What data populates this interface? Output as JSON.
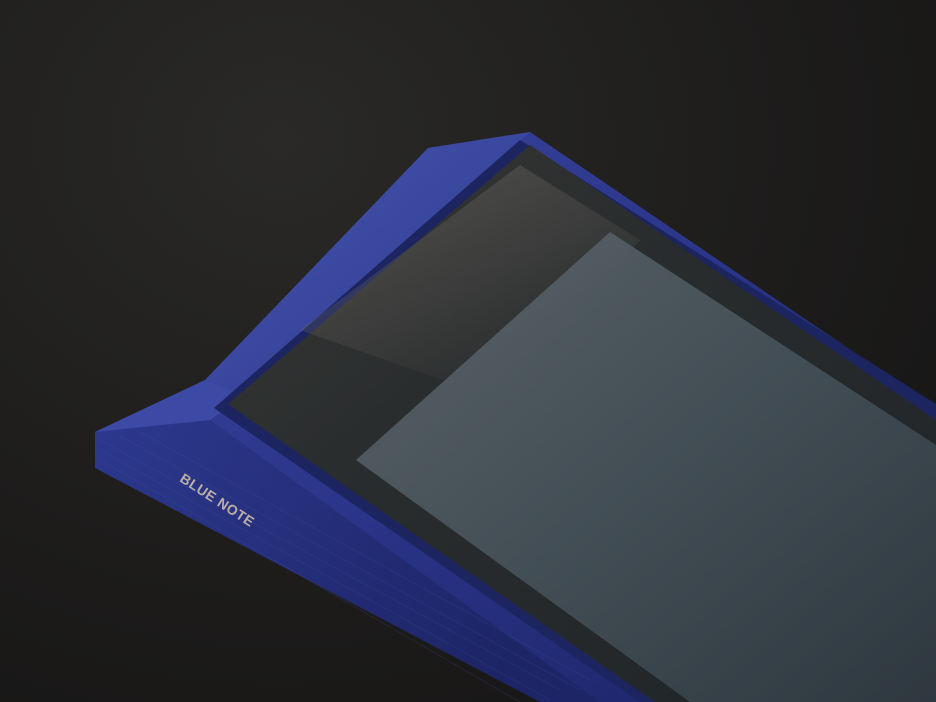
{
  "photo": {
    "engraving_text": "BLUE NOTE",
    "colors": {
      "background": "#1b1a19",
      "device_body": "#2a3488",
      "device_highlight": "#4250a8",
      "screen_glass": "#2b2f30",
      "screen_display": "#46505a"
    }
  }
}
